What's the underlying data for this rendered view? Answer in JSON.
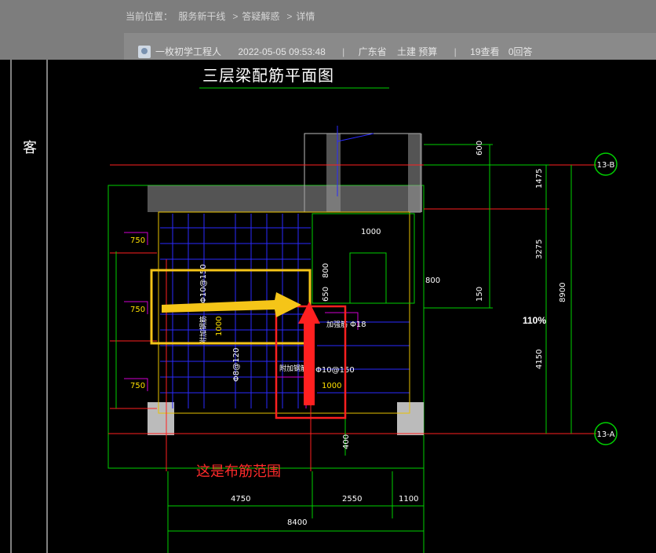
{
  "breadcrumb": {
    "label": "当前位置：",
    "items": [
      "服务新干线",
      "答疑解惑",
      "详情"
    ],
    "sep": ">"
  },
  "post_meta": {
    "author": "一枚初学工程人",
    "datetime": "2022-05-05 09:53:48",
    "region": "广东省",
    "tags": "土建 预算",
    "views": "19查看",
    "answers": "0回答",
    "divider": "|"
  },
  "drawing": {
    "title": "三层梁配筋平面图",
    "side_label": "客",
    "annotation": "这是布筋范围",
    "percent": "110%",
    "grid_bubbles": [
      "13-B",
      "13-A"
    ],
    "dims_right": [
      "600",
      "1475",
      "3275",
      "150",
      "4150",
      "8900"
    ],
    "dims_bottom": [
      "4750",
      "2550",
      "1100",
      "8400",
      "400"
    ],
    "dims_left": [
      "750",
      "750",
      "750"
    ],
    "dims_inner": [
      "1000",
      "800",
      "800",
      "650",
      "1000",
      "1000"
    ],
    "rebar_labels": [
      "Φ10@150",
      "Φ8@120",
      "Φ10@150",
      "Φ18",
      "附加钢筋",
      "附加钢筋",
      "加强筋"
    ],
    "colors": {
      "arrow": "#ff2020",
      "highlight_box": "#f5c518",
      "red_box": "#ff2020",
      "rebar_blue": "#2a2aff",
      "grid_green": "#00d000"
    }
  }
}
